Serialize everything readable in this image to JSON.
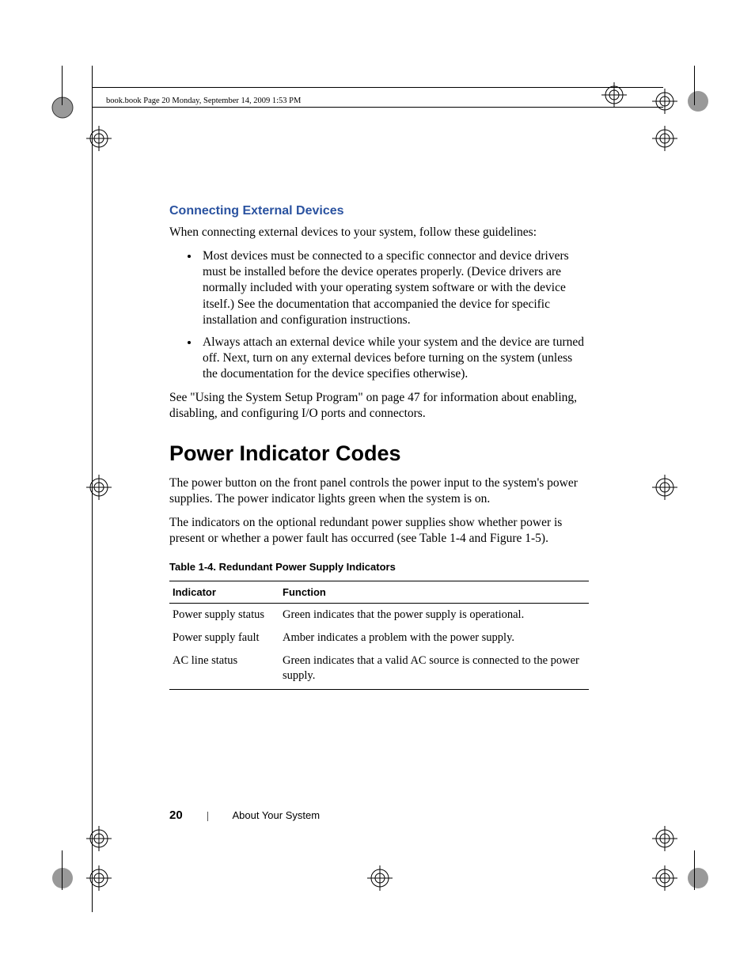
{
  "header": {
    "crop_text": "book.book  Page 20  Monday, September 14, 2009  1:53 PM"
  },
  "section": {
    "subheading": "Connecting External Devices",
    "p1": "When connecting external devices to your system, follow these guidelines:",
    "bullets": [
      "Most devices must be connected to a specific connector and device drivers must be installed before the device operates properly. (Device drivers are normally included with your operating system software or with the device itself.) See the documentation that accompanied the device for specific installation and configuration instructions.",
      "Always attach an external device while your system and the device are turned off. Next, turn on any external devices before turning on the system (unless the documentation for the device specifies otherwise)."
    ],
    "p2": "See \"Using the System Setup Program\" on page 47 for information about enabling, disabling, and configuring I/O ports and connectors.",
    "main_heading": "Power Indicator Codes",
    "p3": "The power button on the front panel controls the power input to the system's power supplies. The power indicator lights green when the system is on.",
    "p4": "The indicators on the optional redundant power supplies show whether power is present or whether a power fault has occurred (see Table 1-4 and Figure 1-5).",
    "table_caption": "Table 1-4.    Redundant Power Supply Indicators",
    "table": {
      "headers": [
        "Indicator",
        "Function"
      ],
      "rows": [
        [
          "Power supply status",
          "Green indicates that the power supply is operational."
        ],
        [
          "Power supply fault",
          "Amber indicates a problem with the power supply."
        ],
        [
          "AC line status",
          "Green indicates that a valid AC source is connected to the power supply."
        ]
      ]
    }
  },
  "footer": {
    "page_number": "20",
    "section_title": "About Your System"
  }
}
